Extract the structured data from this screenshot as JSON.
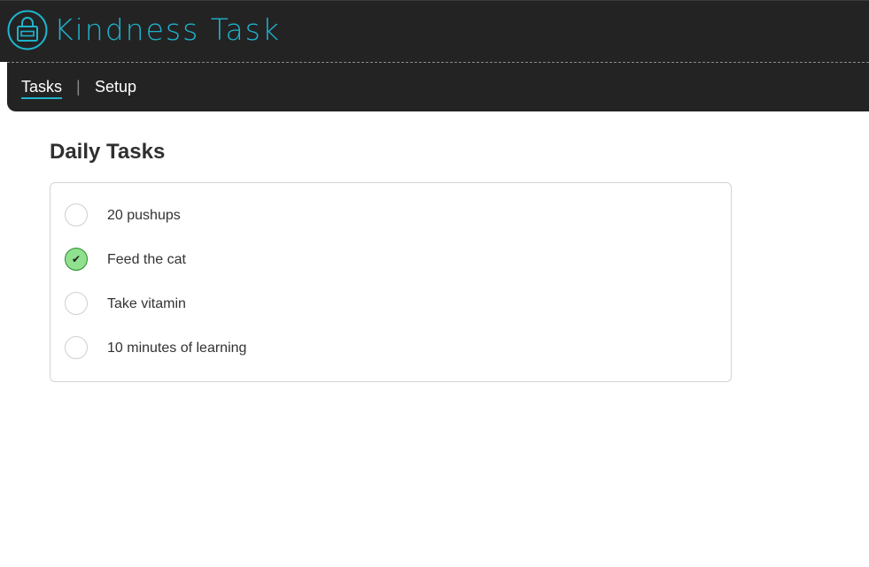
{
  "app": {
    "brand": "Kindness Task",
    "logo_icon": "lock-icon",
    "accent_color": "#1fb3cc"
  },
  "nav": {
    "tasks_label": "Tasks",
    "separator": "|",
    "setup_label": "Setup"
  },
  "main": {
    "title": "Daily Tasks",
    "tasks": [
      {
        "label": "20 pushups",
        "done": false
      },
      {
        "label": "Feed the cat",
        "done": true
      },
      {
        "label": "Take vitamin",
        "done": false
      },
      {
        "label": "10 minutes of learning",
        "done": false
      }
    ],
    "check_glyph": "✔"
  }
}
